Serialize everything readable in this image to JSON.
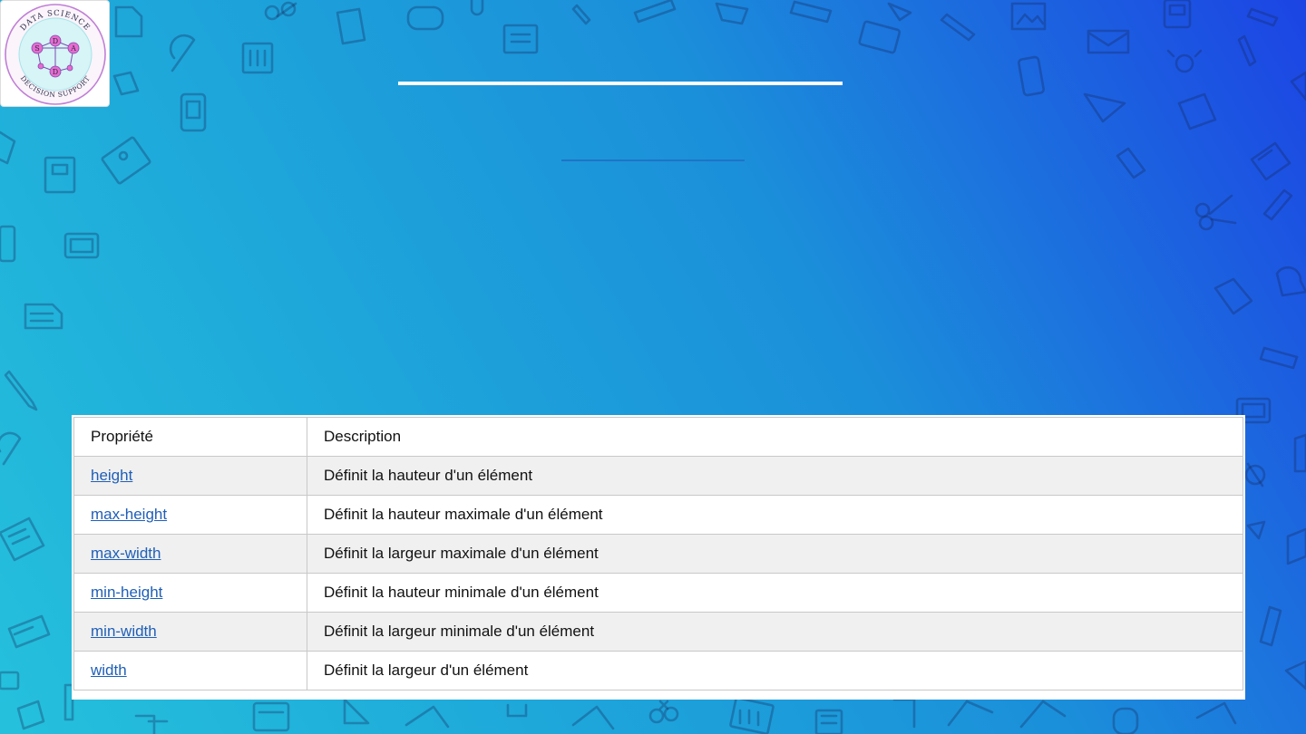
{
  "logo": {
    "top_text": "DATA SCIENCE",
    "bottom_text": "DECISION SUPPORT",
    "letters": [
      "S",
      "D",
      "A",
      "D"
    ]
  },
  "slide": {
    "title": "",
    "subtitle": ""
  },
  "table": {
    "header": {
      "property": "Propriété",
      "description": "Description"
    },
    "rows": [
      {
        "property": "height",
        "description": "Définit la hauteur d'un élément"
      },
      {
        "property": "max-height",
        "description": "Définit la hauteur maximale d'un élément"
      },
      {
        "property": "max-width",
        "description": "Définit la largeur maximale d'un élément"
      },
      {
        "property": "min-height",
        "description": "Définit la hauteur minimale d'un élément"
      },
      {
        "property": "min-width",
        "description": "Définit la largeur minimale d'un élément"
      },
      {
        "property": "width",
        "description": "Définit la largeur d'un élément"
      }
    ]
  },
  "colors": {
    "background_start": "#25c1dc",
    "background_end": "#1c44e4",
    "link": "#1f5fb8",
    "row_alt": "#f0f0f0"
  }
}
